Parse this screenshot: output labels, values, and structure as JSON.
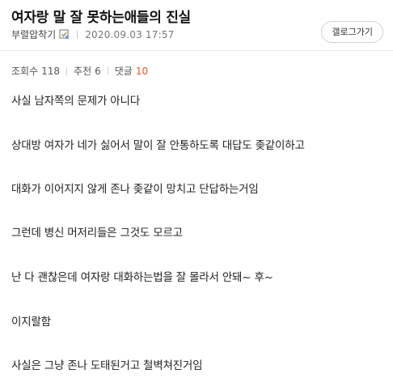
{
  "post": {
    "title": "여자랑 말 잘 못하는애들의 진실",
    "author": "부렬압착기",
    "date": "2020.09.03 17:57",
    "back_button": "갤로그가기",
    "icon": "level-badge-icon"
  },
  "stats": {
    "views_label": "조회수",
    "views": "118",
    "recommend_label": "추천",
    "recommend": "6",
    "comments_label": "댓글",
    "comments": "10",
    "comment_color": "#e0572a"
  },
  "content": {
    "lines": [
      "사실 남자쪽의 문제가 아니다",
      "상대방 여자가 네가 싫어서 말이 잘 안통하도록 대답도 좆같이하고",
      "대화가 이어지지 않게 존나 좆같이 망치고 단답하는거임",
      "그런데 병신 머저리들은 그것도 모르고",
      "난 다 괜찮은데 여자랑 대화하는법을 잘 몰라서 안돼~ 후~",
      "이지랄함",
      "사실은 그냥 존나 도태된거고 철벽쳐진거임"
    ]
  }
}
